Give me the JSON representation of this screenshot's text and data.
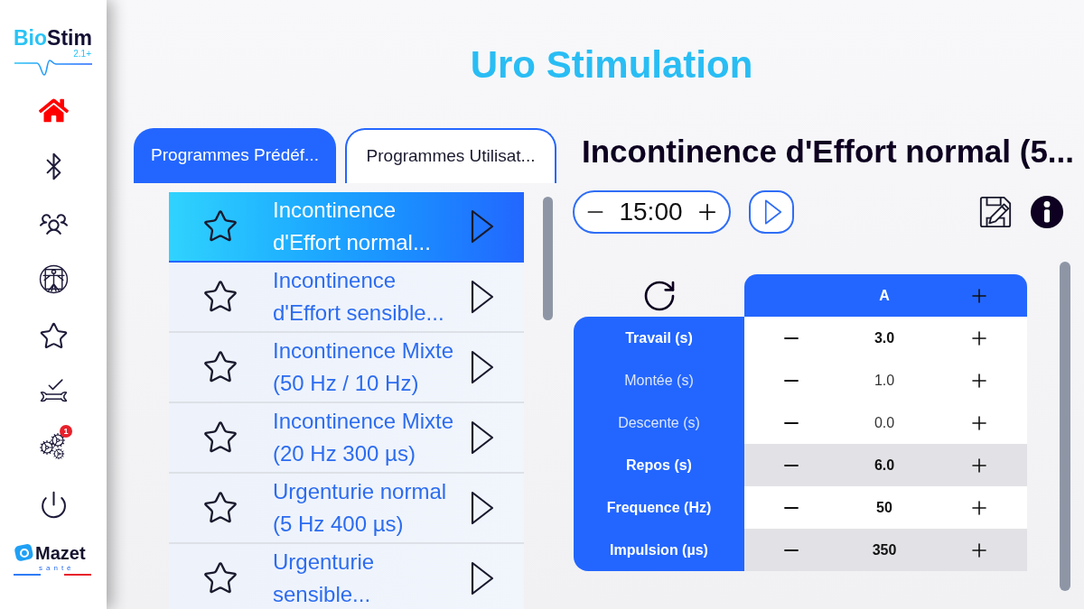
{
  "sidebar": {
    "logo": {
      "parts": [
        {
          "text": "Bio",
          "color": "#29c3f5"
        },
        {
          "text": "Stim",
          "color": "#120f33"
        }
      ],
      "version": "2.1+"
    },
    "items": [
      {
        "selected": true
      },
      {
        "selected": false
      },
      {
        "selected": false
      },
      {
        "selected": false
      },
      {
        "selected": false
      },
      {
        "selected": false
      },
      {
        "selected": false,
        "badge": "1"
      },
      {
        "selected": false
      }
    ],
    "brand": {
      "name": "Mazet",
      "tagline": "santé"
    }
  },
  "page_title": "Uro Stimulation",
  "tabs": [
    {
      "label": "Programmes Prédéf...",
      "selected": true
    },
    {
      "label": "Programmes Utilisat...",
      "selected": false
    }
  ],
  "programs": [
    {
      "title": "Incontinence\nd'Effort normal...",
      "selected": true
    },
    {
      "title": "Incontinence\nd'Effort sensible...",
      "selected": false
    },
    {
      "title": "Incontinence Mixte\n(50 Hz / 10 Hz)",
      "selected": false
    },
    {
      "title": "Incontinence Mixte\n(20 Hz 300 µs)",
      "selected": false
    },
    {
      "title": "Urgenturie normal\n(5 Hz 400 µs)",
      "selected": false
    },
    {
      "title": "Urgenturie\nsensible...",
      "selected": false
    }
  ],
  "program_title": "Incontinence d'Effort normal (5...",
  "timer": {
    "value": "15:00"
  },
  "parameters": {
    "column": "A",
    "rows": [
      {
        "label": "Travail (s)",
        "value": "3.0",
        "emphasized": true,
        "shaded": false
      },
      {
        "label": "Montée (s)",
        "value": "1.0",
        "emphasized": false,
        "shaded": false
      },
      {
        "label": "Descente (s)",
        "value": "0.0",
        "emphasized": false,
        "shaded": false
      },
      {
        "label": "Repos (s)",
        "value": "6.0",
        "emphasized": true,
        "shaded": true
      },
      {
        "label": "Frequence (Hz)",
        "value": "50",
        "emphasized": true,
        "shaded": false
      },
      {
        "label": "Impulsion (µs)",
        "value": "350",
        "emphasized": true,
        "shaded": true
      }
    ]
  }
}
